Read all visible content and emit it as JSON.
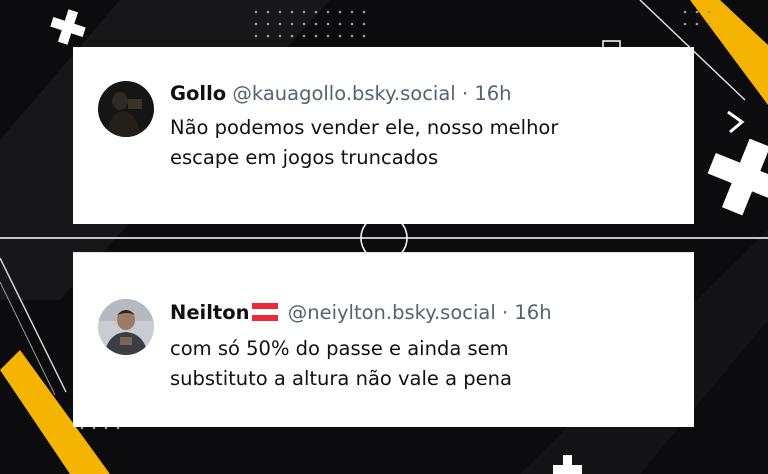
{
  "posts": [
    {
      "author_name": "Gollo",
      "handle": "@kauagollo.bsky.social",
      "separator": "·",
      "time": "16h",
      "text_lines": [
        "Não podemos vender ele, nosso melhor",
        "escape em jogos truncados"
      ],
      "avatar_icon": "avatar-dark-photo"
    },
    {
      "author_name": "Neilton",
      "author_flag": "austria-flag-icon",
      "handle": "@neiylton.bsky.social",
      "separator": "·",
      "time": "16h",
      "text_lines": [
        "com só 50% do passe e ainda sem",
        "substituto a altura não vale a pena"
      ],
      "avatar_icon": "avatar-person-photo"
    }
  ],
  "colors": {
    "background": "#0c0c0e",
    "accent": "#f5b400",
    "card": "#ffffff",
    "meta_text": "#536471"
  }
}
